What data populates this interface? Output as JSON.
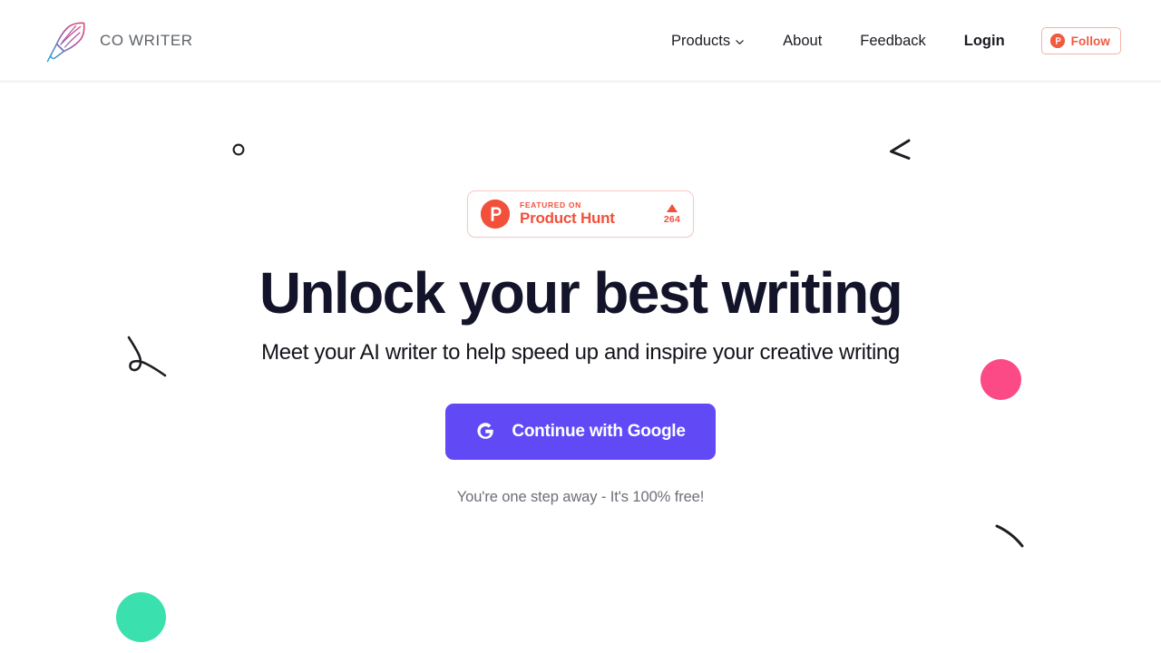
{
  "header": {
    "brand": {
      "name": "CO WRITER",
      "logo_icon": "feather-quill-icon"
    },
    "nav": [
      {
        "label": "Products",
        "bold": false,
        "icon": "chevron-down-icon"
      },
      {
        "label": "About",
        "bold": false
      },
      {
        "label": "Feedback",
        "bold": false
      },
      {
        "label": "Login",
        "bold": true
      }
    ],
    "follow_button": {
      "label": "Follow",
      "icon": "product-hunt-icon"
    }
  },
  "hero": {
    "product_hunt_badge": {
      "featured_label": "FEATURED ON",
      "site_name": "Product Hunt",
      "upvote_count": "264",
      "logo_icon": "product-hunt-icon",
      "upvote_icon": "triangle-up-icon"
    },
    "headline": "Unlock your best writing",
    "subheadline": "Meet your AI writer to help speed up and inspire your creative writing",
    "cta": {
      "label": "Continue with Google",
      "icon": "google-g-icon"
    },
    "note": "You're one step away - It's 100% free!"
  },
  "decorations": [
    {
      "name": "circle-outline-doodle",
      "shape": "circle-outline"
    },
    {
      "name": "angle-bracket-doodle",
      "shape": "angle"
    },
    {
      "name": "squiggle-loop-doodle",
      "shape": "squiggle"
    },
    {
      "name": "arc-stroke-doodle",
      "shape": "arc"
    },
    {
      "name": "pink-dot",
      "shape": "filled-circle"
    },
    {
      "name": "green-dot",
      "shape": "filled-circle"
    }
  ],
  "colors": {
    "brand_purple": "#6149F6",
    "product_hunt": "#F2503A",
    "pink_dot": "#FB4A86",
    "green_dot": "#3AE0AD",
    "headline": "#13142A",
    "muted_text": "#6D6F78",
    "background": "#FFFFFF"
  }
}
